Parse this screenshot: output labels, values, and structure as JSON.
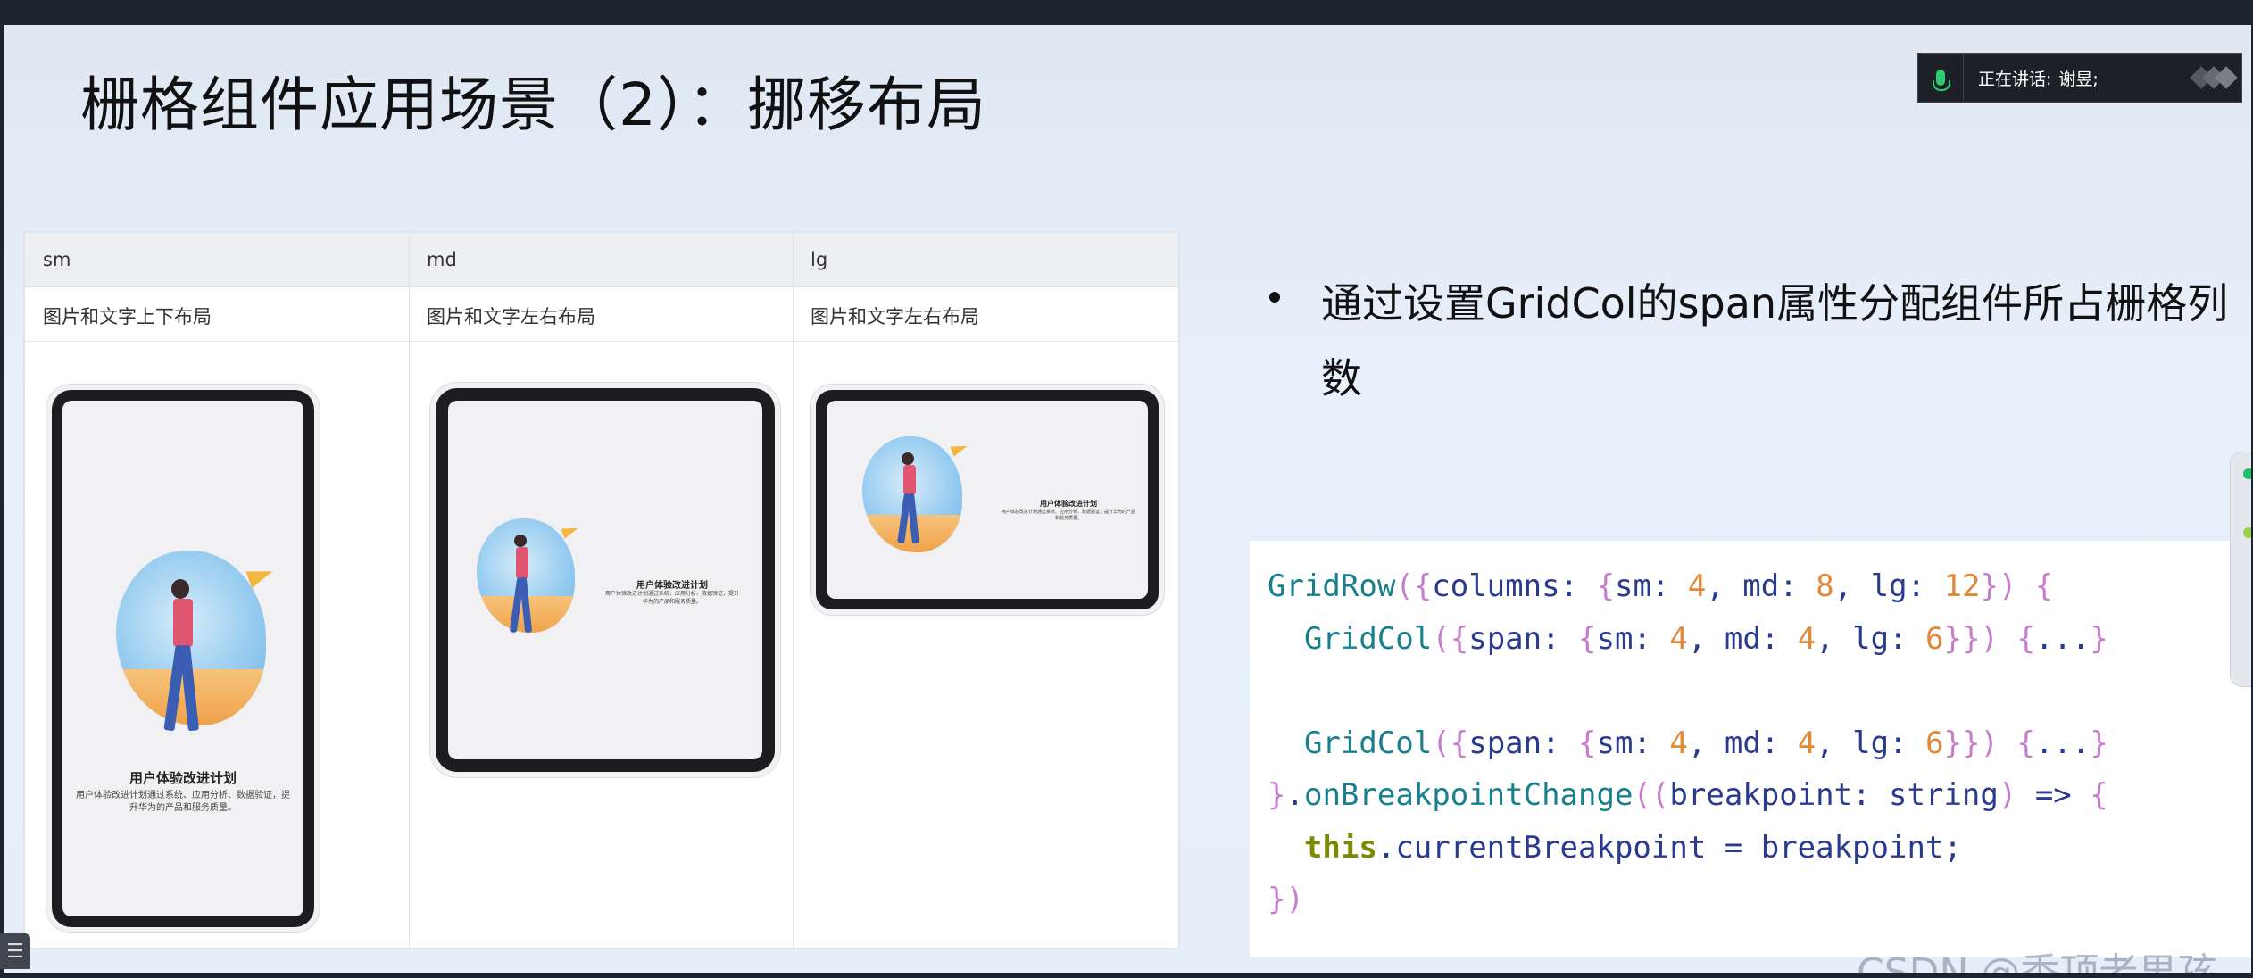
{
  "slide": {
    "title": "栅格组件应用场景（2）：挪移布局"
  },
  "meeting_indicator": {
    "label": "正在讲话:",
    "speaker": "谢昱;"
  },
  "table": {
    "headers": [
      "sm",
      "md",
      "lg"
    ],
    "descriptions": [
      "图片和文字上下布局",
      "图片和文字左右布局",
      "图片和文字左右布局"
    ],
    "device_title": "用户体验改进计划",
    "device_text": "用户体验改进计划通过系统、应用分析、数据验证，提升华为的产品和服务质量。"
  },
  "bullet": {
    "text": "通过设置GridCol的span属性分配组件所占栅格列数"
  },
  "code": {
    "lines": [
      "GridRow({columns: {sm: 4, md: 8, lg: 12}) {",
      "  GridCol({span: {sm: 4, md: 4, lg: 6}}) {...}",
      "",
      "  GridCol({span: {sm: 4, md: 4, lg: 6}}) {...}",
      "}.onBreakpointChange((breakpoint: string) => {",
      "  this.currentBreakpoint = breakpoint;",
      "})"
    ]
  },
  "watermark": "CSDN @秃顶老男孩.",
  "colors": {
    "accent_green": "#2ecc71",
    "code_function": "#187f8f",
    "code_number": "#e08a38",
    "code_brace": "#c77dcc",
    "code_keyword": "#7b8a00"
  },
  "icons": [
    "microphone-icon",
    "menu-icon"
  ]
}
